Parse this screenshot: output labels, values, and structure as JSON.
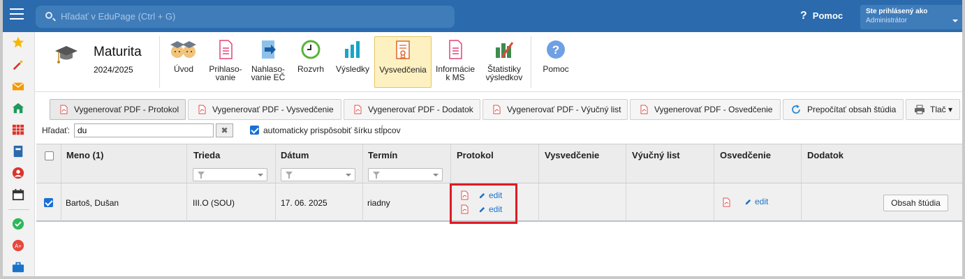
{
  "topbar": {
    "search_placeholder": "Hľadať v EduPage (Ctrl + G)",
    "help_label": "Pomoc",
    "user_line1": "Ste prihlásený ako",
    "user_line2": "Administrátor"
  },
  "module": {
    "title": "Maturita",
    "year": "2024/2025"
  },
  "toolbar": {
    "items": [
      {
        "label": "Úvod",
        "icon": "students-icon"
      },
      {
        "label": "Prihlaso-\nvanie",
        "icon": "document-icon"
      },
      {
        "label": "Nahlaso-\nvanie EČ",
        "icon": "import-icon"
      },
      {
        "label": "Rozvrh",
        "icon": "clock-icon"
      },
      {
        "label": "Výsledky",
        "icon": "bar-chart-icon"
      },
      {
        "label": "Vysvedčenia",
        "icon": "certificate-icon"
      },
      {
        "label": "Informácie\nk MS",
        "icon": "document-icon"
      },
      {
        "label": "Štatistiky\nvýsledkov",
        "icon": "stats-icon"
      },
      {
        "label": "Pomoc",
        "icon": "help-icon"
      }
    ],
    "active_index": 5
  },
  "actions": {
    "buttons": [
      "Vygenerovať PDF - Protokol",
      "Vygenerovať PDF - Vysvedčenie",
      "Vygenerovať PDF - Dodatok",
      "Vygenerovať PDF - Výučný list",
      "Vygenerovať PDF - Osvedčenie",
      "Prepočítať obsah štúdia",
      "Tlač ▾"
    ]
  },
  "search": {
    "label": "Hľadať:",
    "value": "du",
    "clear": "✖",
    "autofit_label": "automaticky prispôsobiť šírku stĺpcov",
    "autofit_checked": true
  },
  "table": {
    "headers": [
      "Meno (1)",
      "Trieda",
      "Dátum",
      "Termín",
      "Protokol",
      "Vysvedčenie",
      "Výučný list",
      "Osvedčenie",
      "Dodatok"
    ],
    "rows": [
      {
        "checked": true,
        "meno": "Bartoš, Dušan",
        "trieda": "III.O (SOU)",
        "datum": "17. 06. 2025",
        "termin": "riadny",
        "protokol_edit_1": "edit",
        "protokol_edit_2": "edit",
        "osvedcenie_edit": "edit",
        "obsah_button": "Obsah štúdia"
      }
    ]
  },
  "colors": {
    "topbar": "#2a6aad",
    "accent": "#1a73c9",
    "highlight": "#e01b24",
    "active_tool": "#fdf1c2"
  }
}
